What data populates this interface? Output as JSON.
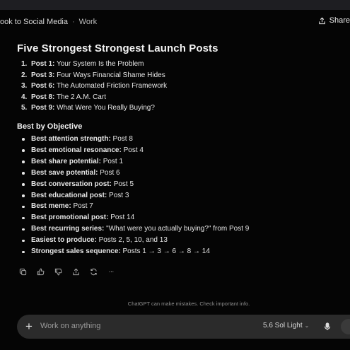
{
  "header": {
    "breadcrumb_1": "ook to Social Media",
    "breadcrumb_sep": "·",
    "breadcrumb_2": "Work",
    "share_label": "Share"
  },
  "title": "Five Strongest Strongest Launch Posts",
  "posts": [
    {
      "num": "1.",
      "label": "Post 1:",
      "text": " Your System Is the Problem"
    },
    {
      "num": "2.",
      "label": "Post 3:",
      "text": " Four Ways Financial Shame Hides"
    },
    {
      "num": "3.",
      "label": "Post 6:",
      "text": " The Automated Friction Framework"
    },
    {
      "num": "4.",
      "label": "Post 8:",
      "text": " The 2 A.M. Cart"
    },
    {
      "num": "5.",
      "label": "Post 9:",
      "text": " What Were You Really Buying?"
    }
  ],
  "objective_heading": "Best by Objective",
  "objectives": [
    {
      "label": "Best attention strength:",
      "value": " Post 8"
    },
    {
      "label": "Best emotional resonance:",
      "value": " Post 4"
    },
    {
      "label": "Best share potential:",
      "value": " Post 1"
    },
    {
      "label": "Best save potential:",
      "value": " Post 6"
    },
    {
      "label": "Best conversation post:",
      "value": " Post 5"
    },
    {
      "label": "Best educational post:",
      "value": " Post 3"
    },
    {
      "label": "Best meme:",
      "value": " Post 7"
    },
    {
      "label": "Best promotional post:",
      "value": " Post 14"
    },
    {
      "label": "Best recurring series:",
      "value": " \"What were you actually buying?\" from Post 9"
    },
    {
      "label": "Easiest to produce:",
      "value": " Posts 2, 5, 10, and 13"
    },
    {
      "label": "Strongest sales sequence:",
      "value": " Posts 1 → 3 → 6 → 8 → 14"
    }
  ],
  "actions": [
    "copy-icon",
    "thumbs-up-icon",
    "thumbs-down-icon",
    "share-icon",
    "regenerate-icon",
    "more-icon"
  ],
  "more_label": "···",
  "disclaimer": "ChatGPT can make mistakes. Check important info.",
  "composer": {
    "plus": "+",
    "placeholder": "Work on anything",
    "model": "5.6 Sol Light",
    "model_chevron": "⌄"
  }
}
